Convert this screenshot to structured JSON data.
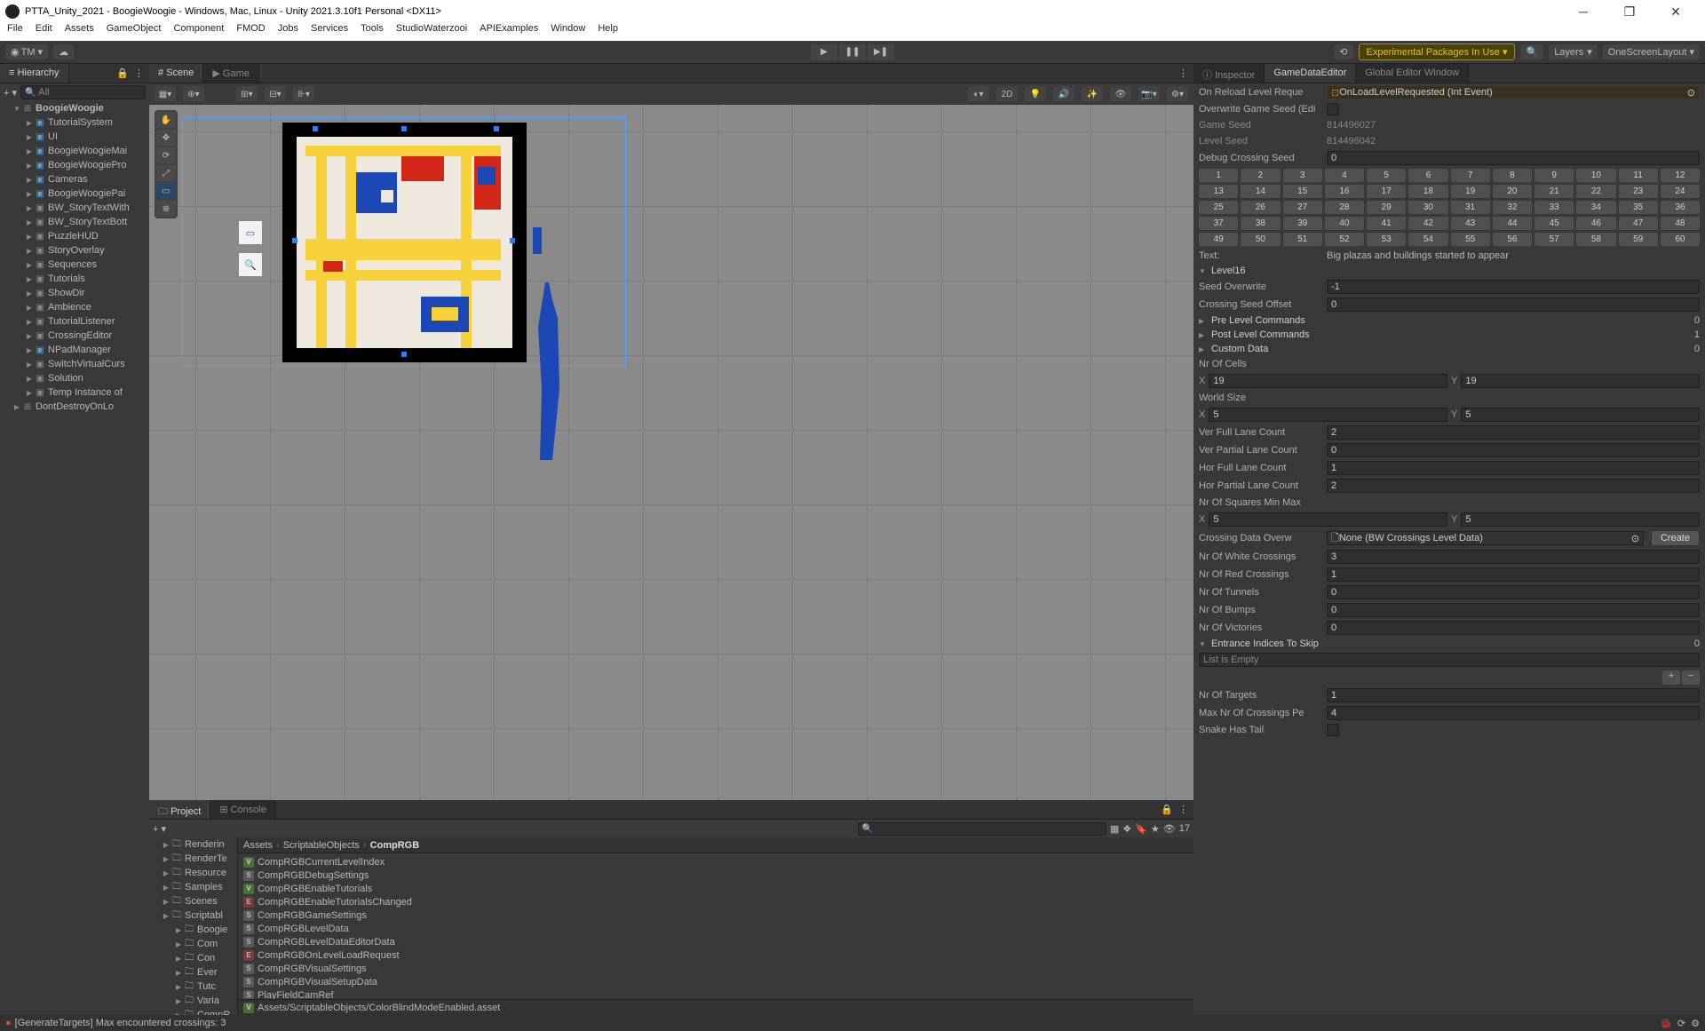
{
  "title": "PTTA_Unity_2021 - BoogieWoogie - Windows, Mac, Linux - Unity 2021.3.10f1 Personal <DX11>",
  "menu": [
    "File",
    "Edit",
    "Assets",
    "GameObject",
    "Component",
    "FMOD",
    "Jobs",
    "Services",
    "Tools",
    "StudioWaterzooi",
    "APIExamples",
    "Window",
    "Help"
  ],
  "toolbar": {
    "tm": "TM ▾",
    "packages": "Experimental Packages In Use ▾",
    "layers": "Layers",
    "layout": "OneScreenLayout ▾"
  },
  "hierarchy": {
    "tab": "Hierarchy",
    "search_placeholder": "All",
    "root": "BoogieWoogie",
    "items": [
      {
        "n": "TutorialSystem",
        "t": "prefab"
      },
      {
        "n": "UI",
        "t": "prefab"
      },
      {
        "n": "BoogieWoogieMai",
        "t": "prefab"
      },
      {
        "n": "BoogieWoogiePro",
        "t": "prefab"
      },
      {
        "n": "Cameras",
        "t": "prefab"
      },
      {
        "n": "BoogieWoogiePai",
        "t": "prefab"
      },
      {
        "n": "BW_StoryTextWith",
        "t": "go"
      },
      {
        "n": "BW_StoryTextBott",
        "t": "go"
      },
      {
        "n": "PuzzleHUD",
        "t": "go"
      },
      {
        "n": "StoryOverlay",
        "t": "go"
      },
      {
        "n": "Sequences",
        "t": "go"
      },
      {
        "n": "Tutorials",
        "t": "go"
      },
      {
        "n": "ShowDir",
        "t": "go"
      },
      {
        "n": "Ambience",
        "t": "go"
      },
      {
        "n": "TutorialListener",
        "t": "go"
      },
      {
        "n": "CrossingEditor",
        "t": "go"
      },
      {
        "n": "NPadManager",
        "t": "prefab"
      },
      {
        "n": "SwitchVirtualCurs",
        "t": "go"
      },
      {
        "n": "Solution",
        "t": "go"
      },
      {
        "n": "Temp Instance of",
        "t": "go"
      }
    ],
    "extra": "DontDestroyOnLo"
  },
  "scene": {
    "tab_scene": "Scene",
    "tab_game": "Game",
    "d2": "2D"
  },
  "project": {
    "tab_project": "Project",
    "tab_console": "Console",
    "search_count": "17",
    "folders": [
      "Renderin",
      "RenderTe",
      "Resource",
      "Samples",
      "Scenes",
      "Scriptabl"
    ],
    "subfolders": [
      "Boogie",
      "Com",
      "Con",
      "Ever",
      "Tutc",
      "Varia",
      "CompR"
    ],
    "breadcrumb": [
      "Assets",
      "ScriptableObjects",
      "CompRGB"
    ],
    "assets": [
      {
        "ic": "v",
        "n": "CompRGBCurrentLevelIndex"
      },
      {
        "ic": "s",
        "n": "CompRGBDebugSettings"
      },
      {
        "ic": "v",
        "n": "CompRGBEnableTutorials"
      },
      {
        "ic": "e",
        "n": "CompRGBEnableTutorialsChanged"
      },
      {
        "ic": "s",
        "n": "CompRGBGameSettings"
      },
      {
        "ic": "s",
        "n": "CompRGBLevelData"
      },
      {
        "ic": "s",
        "n": "CompRGBLevelDataEditorData"
      },
      {
        "ic": "e",
        "n": "CompRGBOnLevelLoadRequest"
      },
      {
        "ic": "s",
        "n": "CompRGBVisualSettings"
      },
      {
        "ic": "s",
        "n": "CompRGBVisualSetupData"
      },
      {
        "ic": "s",
        "n": "PlayFieldCamRef"
      }
    ],
    "footer": "Assets/ScriptableObjects/ColorBlindModeEnabled.asset"
  },
  "inspector": {
    "tab_inspector": "Inspector",
    "tab_gde": "GameDataEditor",
    "tab_gew": "Global Editor Window",
    "on_reload_lbl": "On Reload Level Reque",
    "on_reload_val": "OnLoadLevelRequested (Int Event)",
    "overwrite_seed": "Overwrite Game Seed (Edi",
    "game_seed_lbl": "Game Seed",
    "game_seed": "814496027",
    "level_seed_lbl": "Level Seed",
    "level_seed": "814496042",
    "debug_seed_lbl": "Debug Crossing Seed",
    "debug_seed": "0",
    "nums": [
      "1",
      "2",
      "3",
      "4",
      "5",
      "6",
      "7",
      "8",
      "9",
      "10",
      "11",
      "12",
      "13",
      "14",
      "15",
      "16",
      "17",
      "18",
      "19",
      "20",
      "21",
      "22",
      "23",
      "24",
      "25",
      "26",
      "27",
      "28",
      "29",
      "30",
      "31",
      "32",
      "33",
      "34",
      "35",
      "36",
      "37",
      "38",
      "39",
      "40",
      "41",
      "42",
      "43",
      "44",
      "45",
      "46",
      "47",
      "48",
      "49",
      "50",
      "51",
      "52",
      "53",
      "54",
      "55",
      "56",
      "57",
      "58",
      "59",
      "60"
    ],
    "text_lbl": "Text:",
    "text": "Big plazas and buildings started to appear",
    "level": "Level16",
    "seed_ovw_lbl": "Seed Overwrite",
    "seed_ovw": "-1",
    "cross_off_lbl": "Crossing Seed Offset",
    "cross_off": "0",
    "pre_cmd": "Pre Level Commands",
    "pre_cmd_n": "0",
    "post_cmd": "Post Level Commands",
    "post_cmd_n": "1",
    "custom": "Custom Data",
    "custom_n": "0",
    "cells_lbl": "Nr Of Cells",
    "cells_x": "19",
    "cells_y": "19",
    "world_lbl": "World Size",
    "world_x": "5",
    "world_y": "5",
    "vfull_lbl": "Ver Full Lane Count",
    "vfull": "2",
    "vpart_lbl": "Ver Partial Lane Count",
    "vpart": "0",
    "hfull_lbl": "Hor Full Lane Count",
    "hfull": "1",
    "hpart_lbl": "Hor Partial Lane Count",
    "hpart": "2",
    "sq_lbl": "Nr Of Squares Min Max",
    "sq_x": "5",
    "sq_y": "5",
    "cdata_lbl": "Crossing Data Overw",
    "cdata": "None (BW Crossings Level Data)",
    "create": "Create",
    "white_lbl": "Nr Of White Crossings",
    "white": "3",
    "red_lbl": "Nr Of Red Crossings",
    "red": "1",
    "tun_lbl": "Nr Of Tunnels",
    "tun": "0",
    "bump_lbl": "Nr Of Bumps",
    "bump": "0",
    "vic_lbl": "Nr Of Victories",
    "vic": "0",
    "ent_lbl": "Entrance Indices To Skip",
    "ent_n": "0",
    "ent_empty": "List is Empty",
    "tgt_lbl": "Nr Of Targets",
    "tgt": "1",
    "maxc_lbl": "Max Nr Of Crossings Pe",
    "maxc": "4",
    "snake_lbl": "Snake Has Tail"
  },
  "status": "[GenerateTargets] Max encountered crossings: 3"
}
